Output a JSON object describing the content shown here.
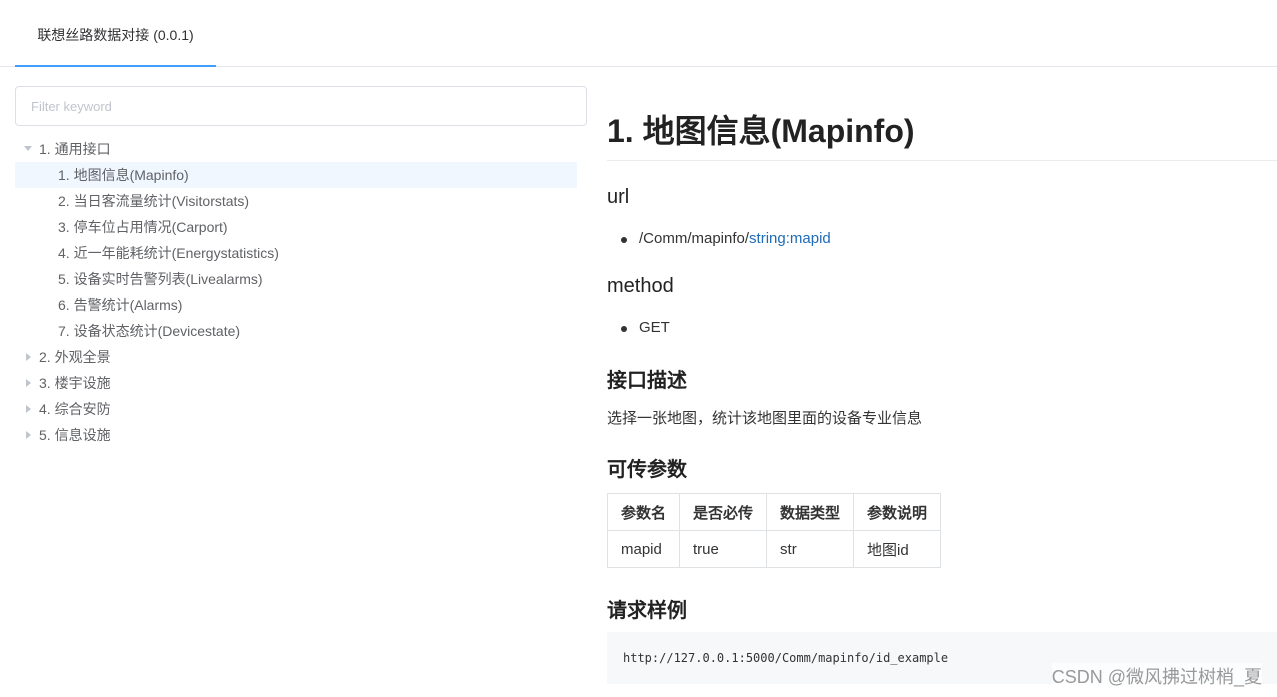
{
  "tabs": [
    {
      "label": "联想丝路数据对接 (0.0.1)"
    }
  ],
  "sidebar": {
    "filter_placeholder": "Filter keyword",
    "tree": [
      {
        "label": "1. 通用接口",
        "expanded": true,
        "children": [
          {
            "label": "1. 地图信息(Mapinfo)",
            "active": true
          },
          {
            "label": "2. 当日客流量统计(Visitorstats)"
          },
          {
            "label": "3. 停车位占用情况(Carport)"
          },
          {
            "label": "4. 近一年能耗统计(Energystatistics)"
          },
          {
            "label": "5. 设备实时告警列表(Livealarms)"
          },
          {
            "label": "6. 告警统计(Alarms)"
          },
          {
            "label": "7. 设备状态统计(Devicestate)"
          }
        ]
      },
      {
        "label": "2. 外观全景",
        "expanded": false
      },
      {
        "label": "3. 楼宇设施",
        "expanded": false
      },
      {
        "label": "4. 综合安防",
        "expanded": false
      },
      {
        "label": "5. 信息设施",
        "expanded": false
      }
    ]
  },
  "content": {
    "title": "1. 地图信息(Mapinfo)",
    "url_heading": "url",
    "url_prefix": "/Comm/mapinfo/",
    "url_param": "string:mapid",
    "method_heading": "method",
    "method": "GET",
    "desc_heading": "接口描述",
    "description": "选择一张地图，统计该地图里面的设备专业信息",
    "params_heading": "可传参数",
    "params_table": {
      "headers": [
        "参数名",
        "是否必传",
        "数据类型",
        "参数说明"
      ],
      "rows": [
        [
          "mapid",
          "true",
          "str",
          "地图id"
        ]
      ]
    },
    "example_heading": "请求样例",
    "example_code": "http://127.0.0.1:5000/Comm/mapinfo/id_example"
  },
  "watermark": "CSDN @微风拂过树梢_夏"
}
